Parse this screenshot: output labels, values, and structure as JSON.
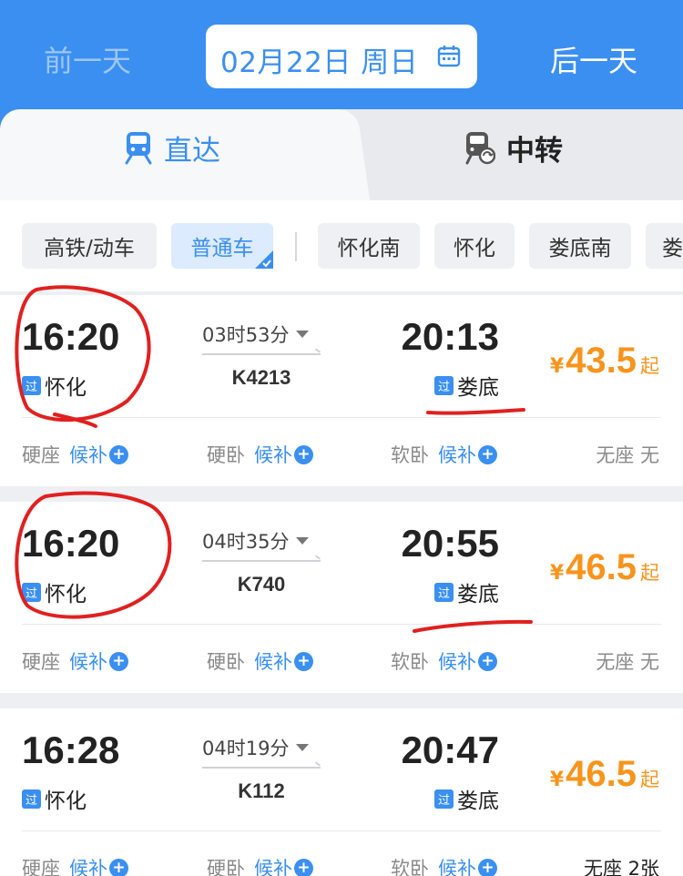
{
  "header": {
    "prev_day": "前一天",
    "next_day": "后一天",
    "date": "02月22日 周日",
    "calendar_icon": "calendar-icon"
  },
  "tabs": [
    {
      "label": "直达",
      "icon": "train-icon",
      "active": true
    },
    {
      "label": "中转",
      "icon": "transfer-train-icon",
      "active": false
    }
  ],
  "filters": {
    "type_chips": [
      "高铁/动车",
      "普通车"
    ],
    "active_type": "普通车",
    "station_chips": [
      "怀化南",
      "怀化",
      "娄底南",
      "娄"
    ]
  },
  "pass_badge": "过",
  "trains": [
    {
      "dep_time": "16:20",
      "dep_station": "怀化",
      "duration": "03时53分",
      "train_no": "K4213",
      "arr_time": "20:13",
      "arr_station": "娄底",
      "price_symbol": "¥",
      "price": "43.5",
      "price_suffix": "起",
      "seats": [
        {
          "name": "硬座",
          "action": "候补"
        },
        {
          "name": "硬卧",
          "action": "候补"
        },
        {
          "name": "软卧",
          "action": "候补"
        }
      ],
      "no_seat": "无座 无"
    },
    {
      "dep_time": "16:20",
      "dep_station": "怀化",
      "duration": "04时35分",
      "train_no": "K740",
      "arr_time": "20:55",
      "arr_station": "娄底",
      "price_symbol": "¥",
      "price": "46.5",
      "price_suffix": "起",
      "seats": [
        {
          "name": "硬座",
          "action": "候补"
        },
        {
          "name": "硬卧",
          "action": "候补"
        },
        {
          "name": "软卧",
          "action": "候补"
        }
      ],
      "no_seat": "无座 无"
    },
    {
      "dep_time": "16:28",
      "dep_station": "怀化",
      "duration": "04时19分",
      "train_no": "K112",
      "arr_time": "20:47",
      "arr_station": "娄底",
      "price_symbol": "¥",
      "price": "46.5",
      "price_suffix": "起",
      "seats": [
        {
          "name": "硬座",
          "action": "候补"
        },
        {
          "name": "硬卧",
          "action": "候补"
        },
        {
          "name": "软卧",
          "action": "候补"
        }
      ],
      "no_seat": "无座 2张"
    }
  ],
  "colors": {
    "brand_blue": "#3a8ff0",
    "price_orange": "#f7941d",
    "annotation_red": "#e02020"
  }
}
